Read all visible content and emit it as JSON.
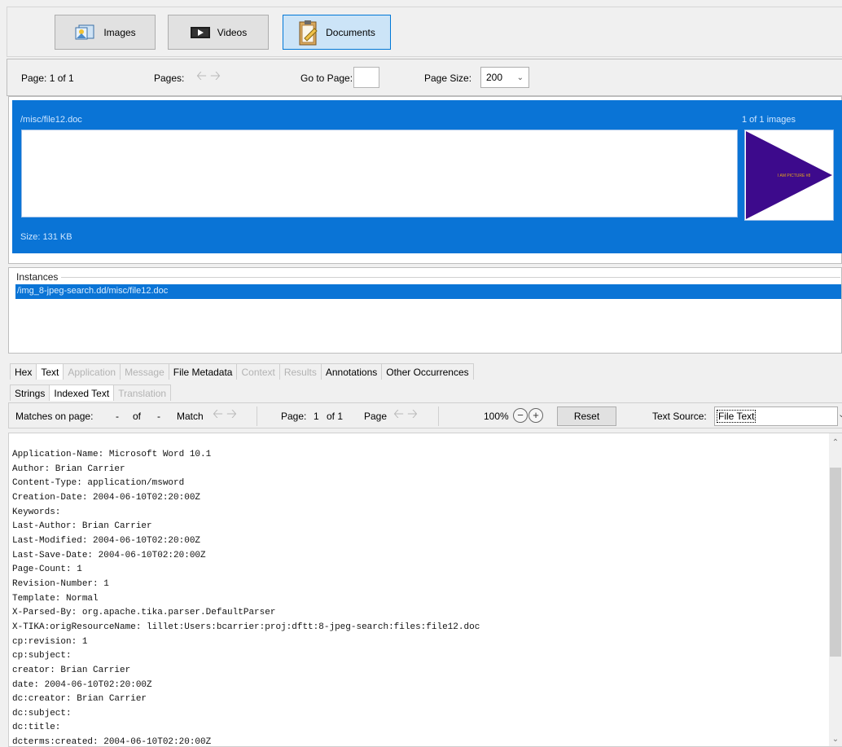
{
  "toolbar": {
    "buttons": [
      {
        "label": "Images",
        "icon": "images-icon"
      },
      {
        "label": "Videos",
        "icon": "videos-icon"
      },
      {
        "label": "Documents",
        "icon": "documents-icon",
        "active": true
      }
    ]
  },
  "pager": {
    "page_text": "Page: 1 of 1",
    "pages_label": "Pages:",
    "goto_label": "Go to Page:",
    "goto_value": "",
    "page_size_label": "Page Size:",
    "page_size_value": "200"
  },
  "result": {
    "path": "/misc/file12.doc",
    "count": "1 of 1 images",
    "size": "Size: 131 KB",
    "thumbnail_text": "I AM PICTURE #8",
    "thumbnail_colors": {
      "background": "#3d0a8c",
      "text": "#e2a51b"
    }
  },
  "instances": {
    "label": "Instances",
    "items": [
      "/img_8-jpeg-search.dd/misc/file12.doc"
    ]
  },
  "tabs": {
    "primary": [
      {
        "label": "Hex",
        "state": "normal"
      },
      {
        "label": "Text",
        "state": "selected"
      },
      {
        "label": "Application",
        "state": "disabled"
      },
      {
        "label": "Message",
        "state": "disabled"
      },
      {
        "label": "File Metadata",
        "state": "normal"
      },
      {
        "label": "Context",
        "state": "disabled"
      },
      {
        "label": "Results",
        "state": "disabled"
      },
      {
        "label": "Annotations",
        "state": "normal"
      },
      {
        "label": "Other Occurrences",
        "state": "normal"
      }
    ],
    "secondary": [
      {
        "label": "Strings",
        "state": "normal"
      },
      {
        "label": "Indexed Text",
        "state": "selected"
      },
      {
        "label": "Translation",
        "state": "disabled"
      }
    ]
  },
  "textbar": {
    "matches_label": "Matches on page:",
    "matches_a": "-",
    "of_label": "of",
    "matches_b": "-",
    "match_label": "Match",
    "page_label": "Page:",
    "page_num": "1",
    "page_of": "of 1",
    "page2_label": "Page",
    "zoom": "100%",
    "reset_label": "Reset",
    "text_source_label": "Text Source:",
    "text_source_value": "File Text"
  },
  "content_lines": [
    "Application-Name: Microsoft Word 10.1",
    "Author: Brian Carrier",
    "Content-Type: application/msword",
    "Creation-Date: 2004-06-10T02:20:00Z",
    "Keywords:",
    "Last-Author: Brian Carrier",
    "Last-Modified: 2004-06-10T02:20:00Z",
    "Last-Save-Date: 2004-06-10T02:20:00Z",
    "Page-Count: 1",
    "Revision-Number: 1",
    "Template: Normal",
    "X-Parsed-By: org.apache.tika.parser.DefaultParser",
    "X-TIKA:origResourceName: lillet:Users:bcarrier:proj:dftt:8-jpeg-search:files:file12.doc",
    "cp:revision: 1",
    "cp:subject:",
    "creator: Brian Carrier",
    "date: 2004-06-10T02:20:00Z",
    "dc:creator: Brian Carrier",
    "dc:subject:",
    "dc:title:",
    "dcterms:created: 2004-06-10T02:20:00Z"
  ]
}
